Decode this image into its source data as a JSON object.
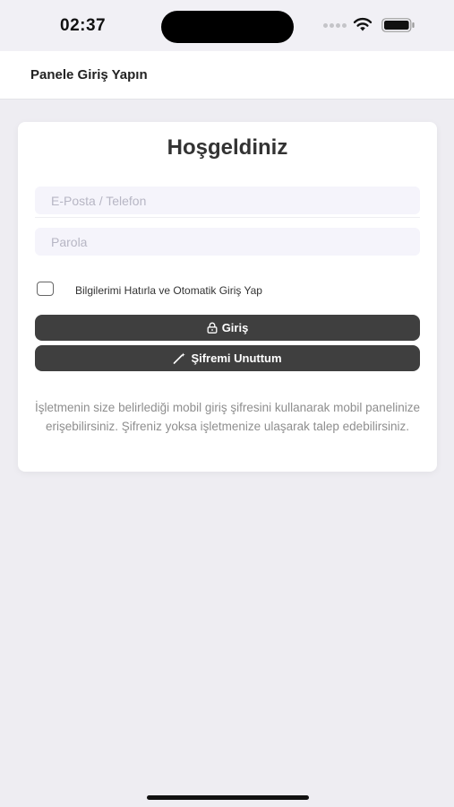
{
  "status_bar": {
    "time": "02:37",
    "icons": [
      "cellular-signal-icon",
      "wifi-icon",
      "battery-icon"
    ]
  },
  "header": {
    "title": "Panele Giriş Yapın"
  },
  "login_card": {
    "title": "Hoşgeldiniz",
    "email_placeholder": "E-Posta / Telefon",
    "email_value": "",
    "password_placeholder": "Parola",
    "password_value": "",
    "remember_label": "Bilgilerimi Hatırla ve Otomatik Giriş Yap",
    "remember_checked": false,
    "login_button": {
      "label": "Giriş",
      "icon": "lock-icon"
    },
    "forgot_button": {
      "label": "Şifremi Unuttum",
      "icon": "magic-wand-icon"
    },
    "info_text": "İşletmenin size belirlediği mobil giriş şifresini kullanarak mobil panelinize erişebilirsiniz. Şifreniz yoksa işletmenize ulaşarak talep edebilirsiniz."
  },
  "colors": {
    "background": "#eeedf2",
    "card": "#ffffff",
    "button": "#3f3f3f",
    "input_bg": "#f5f4fb",
    "placeholder": "#b7b6c4",
    "info_text": "#8e8e8e"
  }
}
